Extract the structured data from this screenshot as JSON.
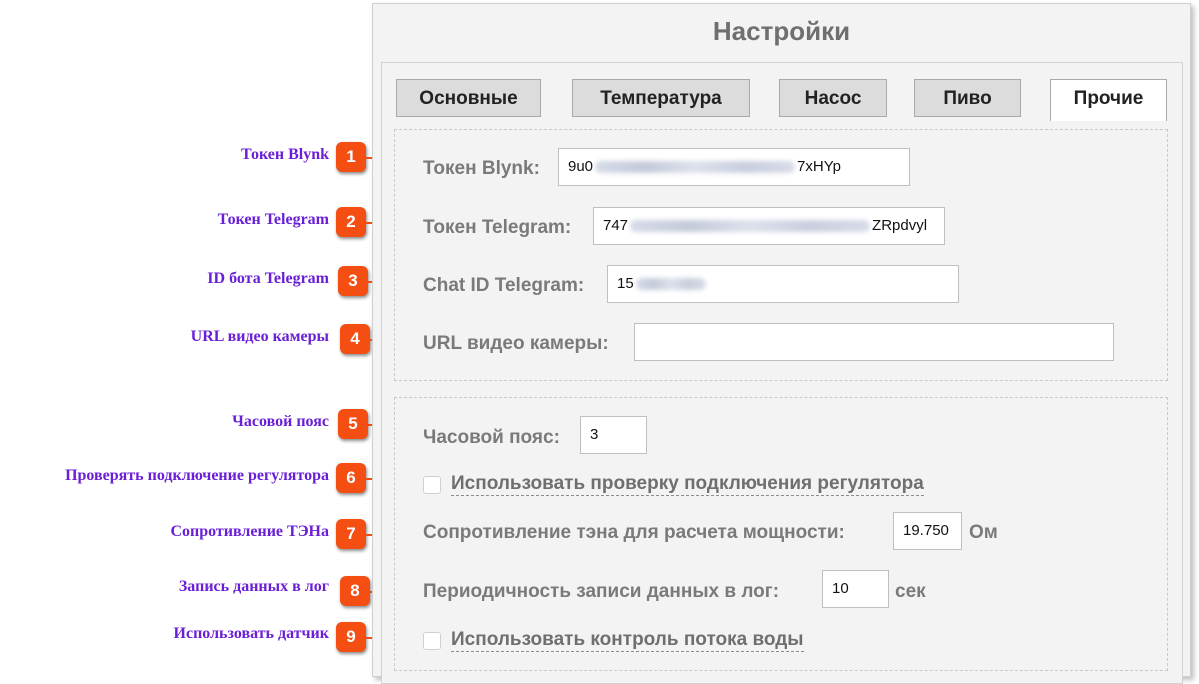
{
  "panel": {
    "title": "Настройки",
    "tabs": [
      {
        "label": "Основные",
        "active": false
      },
      {
        "label": "Температура",
        "active": false
      },
      {
        "label": "Насос",
        "active": false
      },
      {
        "label": "Пиво",
        "active": false
      },
      {
        "label": "Прочие",
        "active": true
      }
    ]
  },
  "fields": {
    "blynk": {
      "label": "Токен Blynk:",
      "value_start": "9u0",
      "value_end": "7xHYp"
    },
    "telegram": {
      "label": "Токен Telegram:",
      "value_start": "747",
      "value_end": "ZRpdvyl"
    },
    "chat_id": {
      "label": "Chat ID Telegram:",
      "value_start": "15"
    },
    "camera": {
      "label": "URL видео камеры:",
      "value": ""
    },
    "timezone": {
      "label": "Часовой пояс:",
      "value": "3"
    },
    "check_regulator": {
      "label": "Использовать проверку подключения регулятора",
      "checked": false
    },
    "resistance": {
      "label": "Сопротивление тэна для расчета мощности:",
      "value": "19.750",
      "unit": "Ом"
    },
    "log_period": {
      "label": "Периодичность записи данных в лог:",
      "value": "10",
      "unit": "сек"
    },
    "flow_control": {
      "label": "Использовать контроль потока воды",
      "checked": false
    }
  },
  "annotations": [
    {
      "num": "1",
      "label": "Токен Blynk"
    },
    {
      "num": "2",
      "label": "Токен Telegram"
    },
    {
      "num": "3",
      "label": "ID бота Telegram"
    },
    {
      "num": "4",
      "label": "URL видео камеры"
    },
    {
      "num": "5",
      "label": "Часовой пояс"
    },
    {
      "num": "6",
      "label": "Проверять подключение регулятора"
    },
    {
      "num": "7",
      "label": "Сопротивление ТЭНа"
    },
    {
      "num": "8",
      "label": "Запись данных в лог"
    },
    {
      "num": "9",
      "label": "Использовать датчик"
    }
  ],
  "colors": {
    "annotation_text": "#6a1fd6",
    "badge": "#f44e12",
    "label_gray": "#7a7a7a"
  }
}
